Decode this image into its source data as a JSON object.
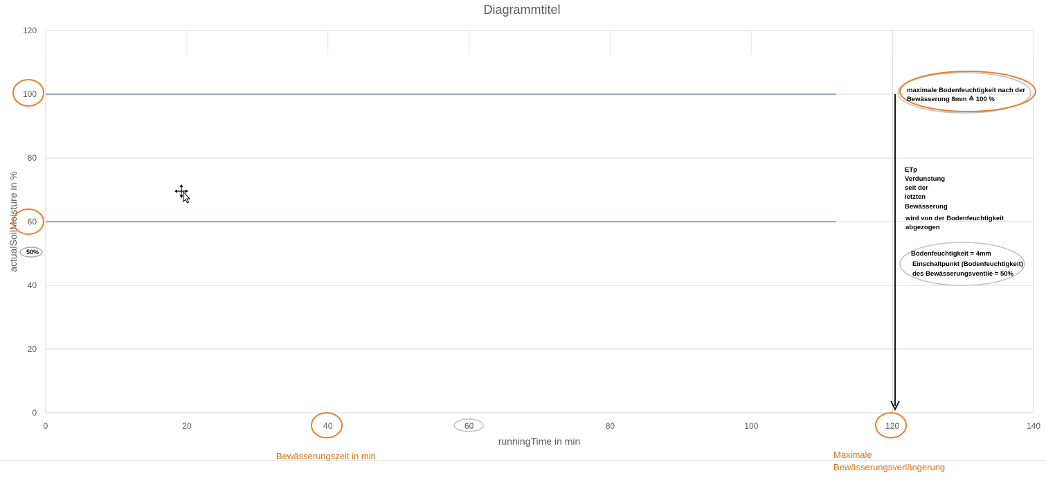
{
  "chart_data": {
    "type": "line",
    "title": "Diagrammtitel",
    "xlabel": "runningTime in min",
    "ylabel": "actualSoilMoisture in %",
    "xlim": [
      0,
      140
    ],
    "ylim": [
      0,
      120
    ],
    "x_ticks": [
      "0",
      "20",
      "40",
      "60",
      "80",
      "100",
      "120",
      "140"
    ],
    "y_ticks": [
      "0",
      "20",
      "40",
      "60",
      "80",
      "100",
      "120"
    ],
    "grid": true,
    "series": [
      {
        "values": [
          [
            0,
            100
          ],
          [
            112,
            100
          ]
        ]
      },
      {
        "values": [
          [
            0,
            60
          ],
          [
            112,
            60
          ]
        ]
      }
    ],
    "annotations": {
      "x_axis_irrigation_time": "Bewässerungszeit in min",
      "x_axis_max_extension": [
        "Maximale",
        "Bewässerungsverlängerung"
      ],
      "max_moisture_note": [
        "maximale Bodenfeuchtigkeit nach der",
        "Bewässerung 8mm ≙ 100 %"
      ],
      "etp_note": [
        "ETp",
        "Verdunstung",
        "seit der",
        "letzten",
        "Bewässerung"
      ],
      "deduct_note": [
        "wird von der Bodenfeuchtigkeit",
        "abgezogen"
      ],
      "switch_point_note": [
        "Bodenfeuchtigkeit = 4mm",
        "Einschaltpunkt (Bodenfeuchtigkeit)",
        "des Bewässerungsventile = 50%"
      ],
      "badge_50": "50%"
    },
    "colors": {
      "series_line": "#2f5597",
      "highlight_orange": "#ed7d31",
      "highlight_gray": "#bfbfbf",
      "text": "#595959",
      "grid": "#d9d9d9"
    }
  }
}
